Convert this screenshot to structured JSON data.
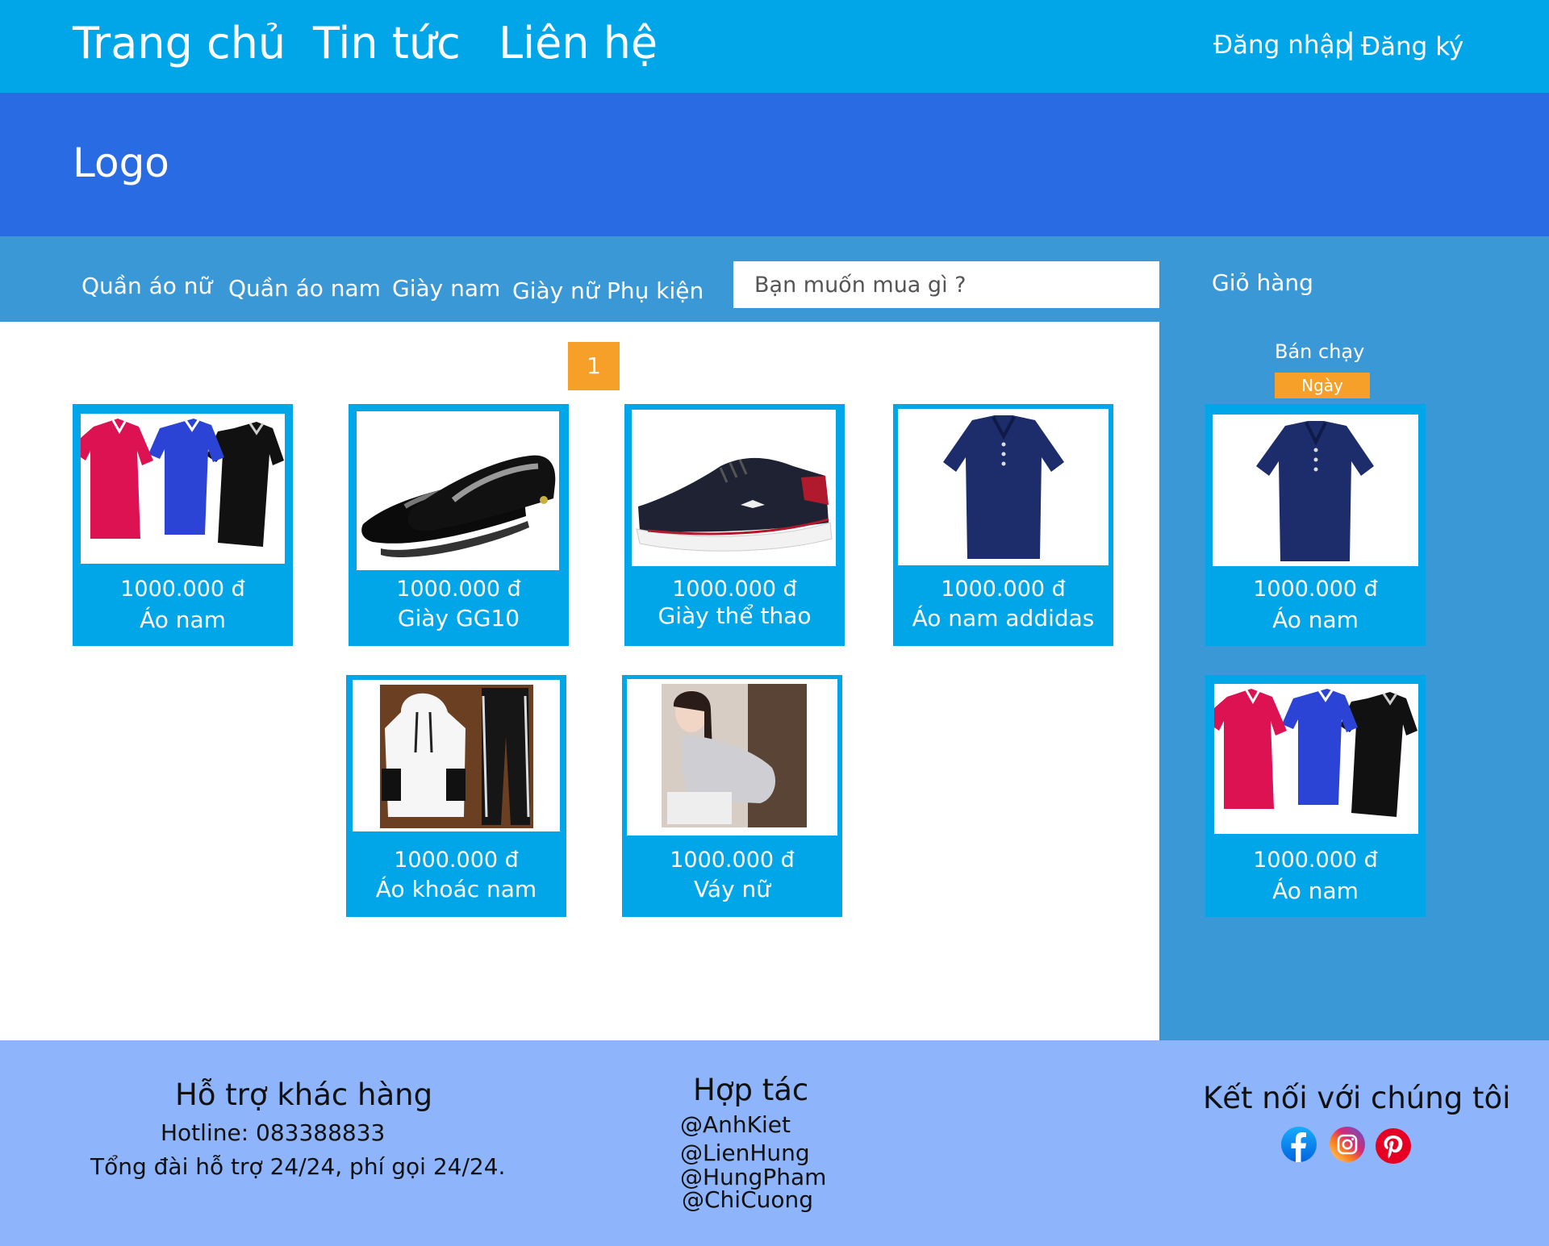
{
  "header": {
    "nav": [
      "Trang chủ",
      "Tin tức",
      "Liên hệ"
    ],
    "login": "Đăng nhập",
    "separator": "|",
    "register": "Đăng ký"
  },
  "banner": {
    "logo": "Logo"
  },
  "categories": [
    "Quần áo nữ",
    "Quần áo nam",
    "Giày nam",
    "Giày nữ",
    "Phụ kiện"
  ],
  "search": {
    "placeholder": "Bạn muốn mua gì ?"
  },
  "sidebar": {
    "cart_label": "Giỏ hàng",
    "best_seller": "Bán chạy",
    "filter_badge": "Ngày",
    "products": [
      {
        "price": "1000.000 đ",
        "name": "Áo nam",
        "image": "navy-polo-shirt"
      },
      {
        "price": "1000.000 đ",
        "name": "Áo nam",
        "image": "three-polo-shirts"
      }
    ]
  },
  "pagination": {
    "current": "1"
  },
  "products": [
    {
      "price": "1000.000 đ",
      "name": "Áo nam",
      "image": "three-polo-shirts"
    },
    {
      "price": "1000.000 đ",
      "name": "Giày GG10",
      "image": "black-loafers"
    },
    {
      "price": "1000.000 đ",
      "name": "Giày thể thao",
      "image": "sneaker"
    },
    {
      "price": "1000.000 đ",
      "name": "Áo nam addidas",
      "image": "navy-polo-shirt"
    },
    {
      "price": "1000.000 đ",
      "name": "Áo khoác nam",
      "image": "hoodie-set"
    },
    {
      "price": "1000.000 đ",
      "name": "Váy nữ",
      "image": "woman-dress"
    }
  ],
  "footer": {
    "support": {
      "title": "Hỗ trợ khác hàng",
      "hotline": "Hotline: 083388833",
      "note": "Tổng đài hỗ trợ 24/24, phí gọi 24/24."
    },
    "partners": {
      "title": "Hợp tác",
      "items": [
        "@AnhKiet",
        "@LienHung",
        "@HungPham",
        "@ChiCuong"
      ]
    },
    "connect": {
      "title": "Kết nối với chúng tôi",
      "icons": [
        "facebook-icon",
        "instagram-icon",
        "pinterest-icon"
      ]
    }
  },
  "colors": {
    "topbar": "#00a6e8",
    "banner": "#286be3",
    "category_bar": "#3a98d6",
    "card": "#00a6e8",
    "accent": "#f6a02a",
    "footer": "#8eb4fb"
  }
}
